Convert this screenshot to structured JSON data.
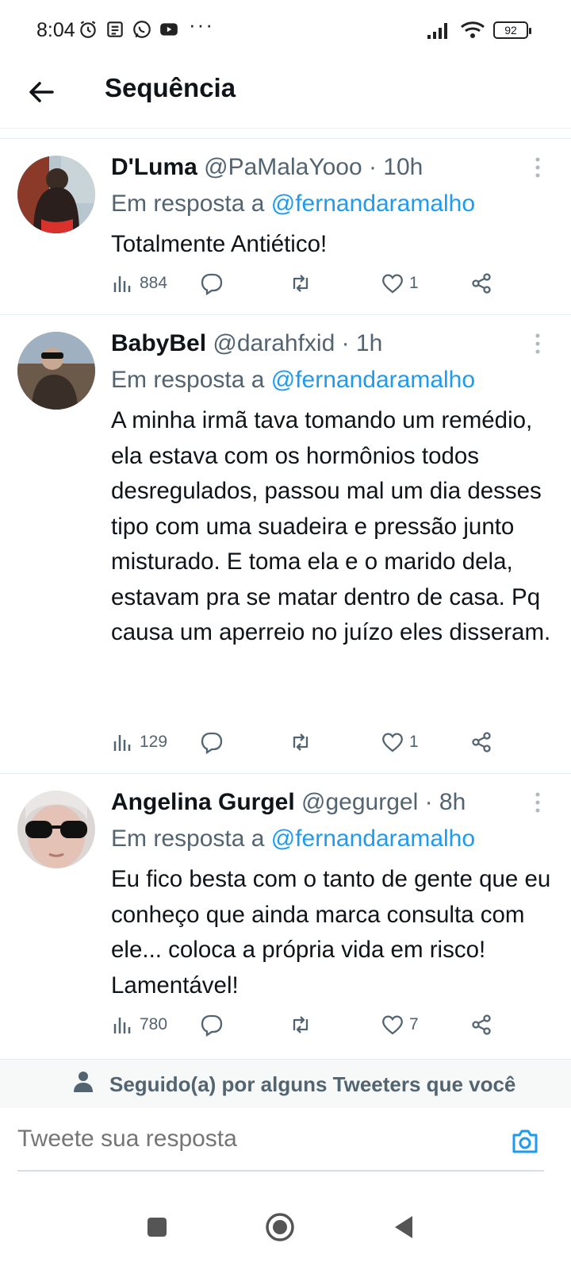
{
  "status_bar": {
    "time": "8:04",
    "dots": "···",
    "battery": "92"
  },
  "header": {
    "title": "Sequência"
  },
  "tweets": [
    {
      "name": "D'Luma",
      "handle": "@PaMalaYooo",
      "time": "· 10h",
      "reply_prefix": "Em resposta a ",
      "reply_to": "@fernandaramalho",
      "body": "Totalmente Antiético!",
      "views": "884",
      "likes": "1"
    },
    {
      "name": "BabyBel",
      "handle": "@darahfxid",
      "time": "· 1h",
      "reply_prefix": "Em resposta a ",
      "reply_to": "@fernandaramalho",
      "body": "A minha irmã tava tomando um remédio, ela estava com os hormônios todos desregulados, passou mal um dia desses tipo com uma suadeira e pressão junto misturado. E toma ela e o marido dela, estavam pra se matar dentro de casa. Pq causa um aperreio no juízo eles disseram.",
      "views": "129",
      "likes": "1"
    },
    {
      "name": "Angelina Gurgel",
      "handle": "@gegurgel",
      "time": "· 8h",
      "reply_prefix": "Em resposta a ",
      "reply_to": "@fernandaramalho",
      "body": "Eu fico besta com o tanto de gente que eu conheço que ainda marca consulta com ele... coloca a própria vida em risco! Lamentável!",
      "views": "780",
      "likes": "7"
    }
  ],
  "followed_by": {
    "text": "Seguido(a) por alguns Tweeters que você"
  },
  "reply_box": {
    "placeholder": "Tweete sua resposta"
  },
  "colors": {
    "accent": "#1d9bf0",
    "secondary_text": "#536471",
    "primary_text": "#0f1419"
  },
  "icons": [
    "back-arrow-icon",
    "views-icon",
    "reply-icon",
    "retweet-icon",
    "like-icon",
    "share-icon",
    "more-icon",
    "person-icon",
    "camera-icon"
  ]
}
